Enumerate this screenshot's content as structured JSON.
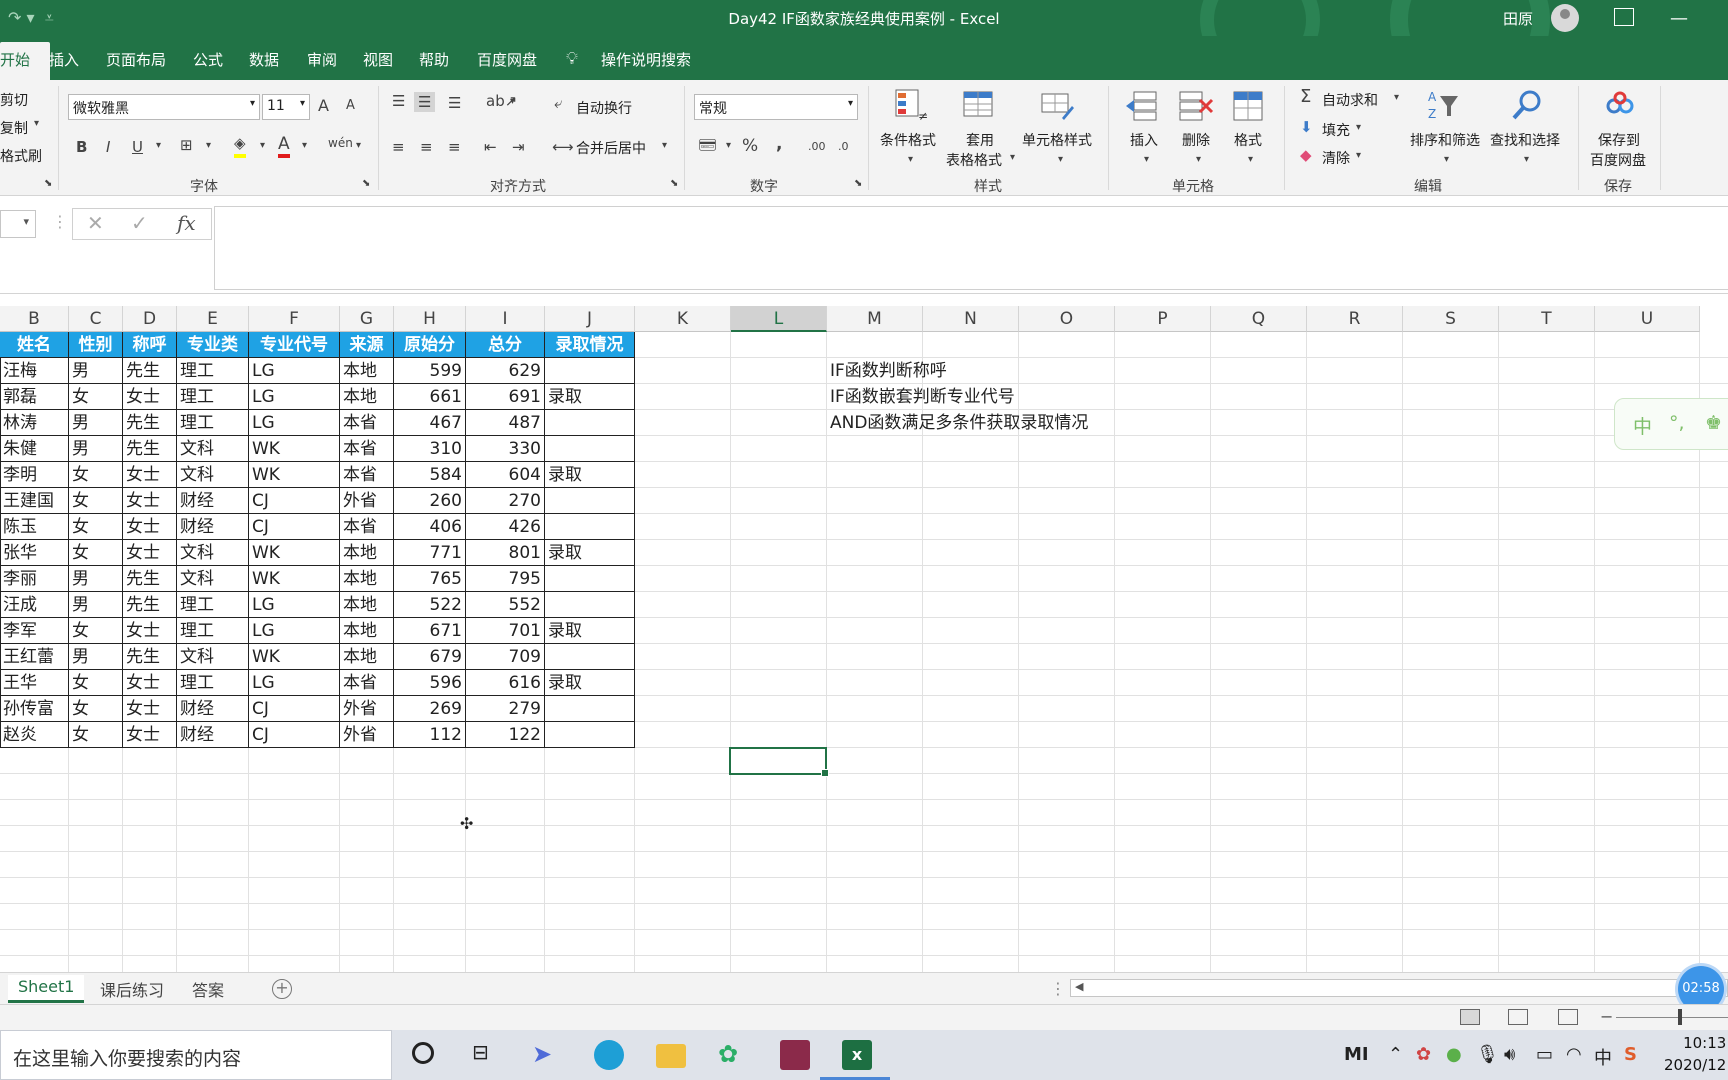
{
  "window": {
    "title": "Day42 IF函数家族经典使用案例  -  Excel",
    "user": "田原"
  },
  "tabs": [
    {
      "label": "开始",
      "active": true
    },
    {
      "label": "插入"
    },
    {
      "label": "页面布局"
    },
    {
      "label": "公式"
    },
    {
      "label": "数据"
    },
    {
      "label": "审阅"
    },
    {
      "label": "视图"
    },
    {
      "label": "帮助"
    },
    {
      "label": "百度网盘"
    },
    {
      "label": "操作说明搜索"
    }
  ],
  "ribbon": {
    "clipboard": {
      "cut": "剪切",
      "copy": "复制",
      "painter": "格式刷"
    },
    "font": {
      "name": "微软雅黑",
      "size": "11",
      "group_label": "字体",
      "bold": "B",
      "italic": "I",
      "underline": "U",
      "grow": "A",
      "shrink": "A",
      "font_color": "A",
      "wen": "wén"
    },
    "alignment": {
      "wrap": "自动换行",
      "merge": "合并后居中",
      "group_label": "对齐方式"
    },
    "number": {
      "format": "常规",
      "group_label": "数字",
      "percent": "%",
      "comma": ",",
      "inc_decimal": ".00",
      "dec_decimal": ".0"
    },
    "styles": {
      "conditional": "条件格式",
      "table_format_1": "套用",
      "table_format_2": "表格格式",
      "cell_style": "单元格样式",
      "group_label": "样式"
    },
    "cells": {
      "insert": "插入",
      "delete": "删除",
      "format": "格式",
      "group_label": "单元格"
    },
    "editing": {
      "autosum": "自动求和",
      "fill": "填充",
      "clear": "清除",
      "sort": "排序和筛选",
      "find": "查找和选择",
      "group_label": "编辑"
    },
    "save": {
      "label_1": "保存到",
      "label_2": "百度网盘",
      "group_label": "保存"
    }
  },
  "formula_bar": {
    "cancel": "✕",
    "enter": "✓",
    "fx": "fx",
    "content": ""
  },
  "columns": [
    "B",
    "C",
    "D",
    "E",
    "F",
    "G",
    "H",
    "I",
    "J",
    "K",
    "L",
    "M",
    "N",
    "O",
    "P",
    "Q",
    "R",
    "S",
    "T",
    "U"
  ],
  "selected_column": "L",
  "table": {
    "headers": [
      "姓名",
      "性别",
      "称呼",
      "专业类",
      "专业代号",
      "来源",
      "原始分",
      "总分",
      "录取情况"
    ],
    "rows": [
      [
        "汪梅",
        "男",
        "先生",
        "理工",
        "LG",
        "本地",
        "599",
        "629",
        ""
      ],
      [
        "郭磊",
        "女",
        "女士",
        "理工",
        "LG",
        "本地",
        "661",
        "691",
        "录取"
      ],
      [
        "林涛",
        "男",
        "先生",
        "理工",
        "LG",
        "本省",
        "467",
        "487",
        ""
      ],
      [
        "朱健",
        "男",
        "先生",
        "文科",
        "WK",
        "本省",
        "310",
        "330",
        ""
      ],
      [
        "李明",
        "女",
        "女士",
        "文科",
        "WK",
        "本省",
        "584",
        "604",
        "录取"
      ],
      [
        "王建国",
        "女",
        "女士",
        "财经",
        "CJ",
        "外省",
        "260",
        "270",
        ""
      ],
      [
        "陈玉",
        "女",
        "女士",
        "财经",
        "CJ",
        "本省",
        "406",
        "426",
        ""
      ],
      [
        "张华",
        "女",
        "女士",
        "文科",
        "WK",
        "本地",
        "771",
        "801",
        "录取"
      ],
      [
        "李丽",
        "男",
        "先生",
        "文科",
        "WK",
        "本地",
        "765",
        "795",
        ""
      ],
      [
        "汪成",
        "男",
        "先生",
        "理工",
        "LG",
        "本地",
        "522",
        "552",
        ""
      ],
      [
        "李军",
        "女",
        "女士",
        "理工",
        "LG",
        "本地",
        "671",
        "701",
        "录取"
      ],
      [
        "王红蕾",
        "男",
        "先生",
        "文科",
        "WK",
        "本地",
        "679",
        "709",
        ""
      ],
      [
        "王华",
        "女",
        "女士",
        "理工",
        "LG",
        "本省",
        "596",
        "616",
        "录取"
      ],
      [
        "孙传富",
        "女",
        "女士",
        "财经",
        "CJ",
        "外省",
        "269",
        "279",
        ""
      ],
      [
        "赵炎",
        "女",
        "女士",
        "财经",
        "CJ",
        "外省",
        "112",
        "122",
        ""
      ]
    ]
  },
  "notes": [
    "IF函数判断称呼",
    "IF函数嵌套判断专业代号",
    "AND函数满足多条件获取录取情况"
  ],
  "ime": {
    "mode": "中",
    "punct": "°,"
  },
  "sheets": [
    {
      "name": "Sheet1",
      "active": true
    },
    {
      "name": "课后练习"
    },
    {
      "name": "答案"
    }
  ],
  "add_sheet": "+",
  "timer": "02:58",
  "taskbar": {
    "search_placeholder": "在这里输入你要搜索的内容",
    "clock_time": "10:13",
    "clock_date": "2020/12",
    "ime": "中",
    "brand": "MI"
  },
  "colors": {
    "excel_green": "#217346",
    "header_blue": "#1fa2e4"
  }
}
